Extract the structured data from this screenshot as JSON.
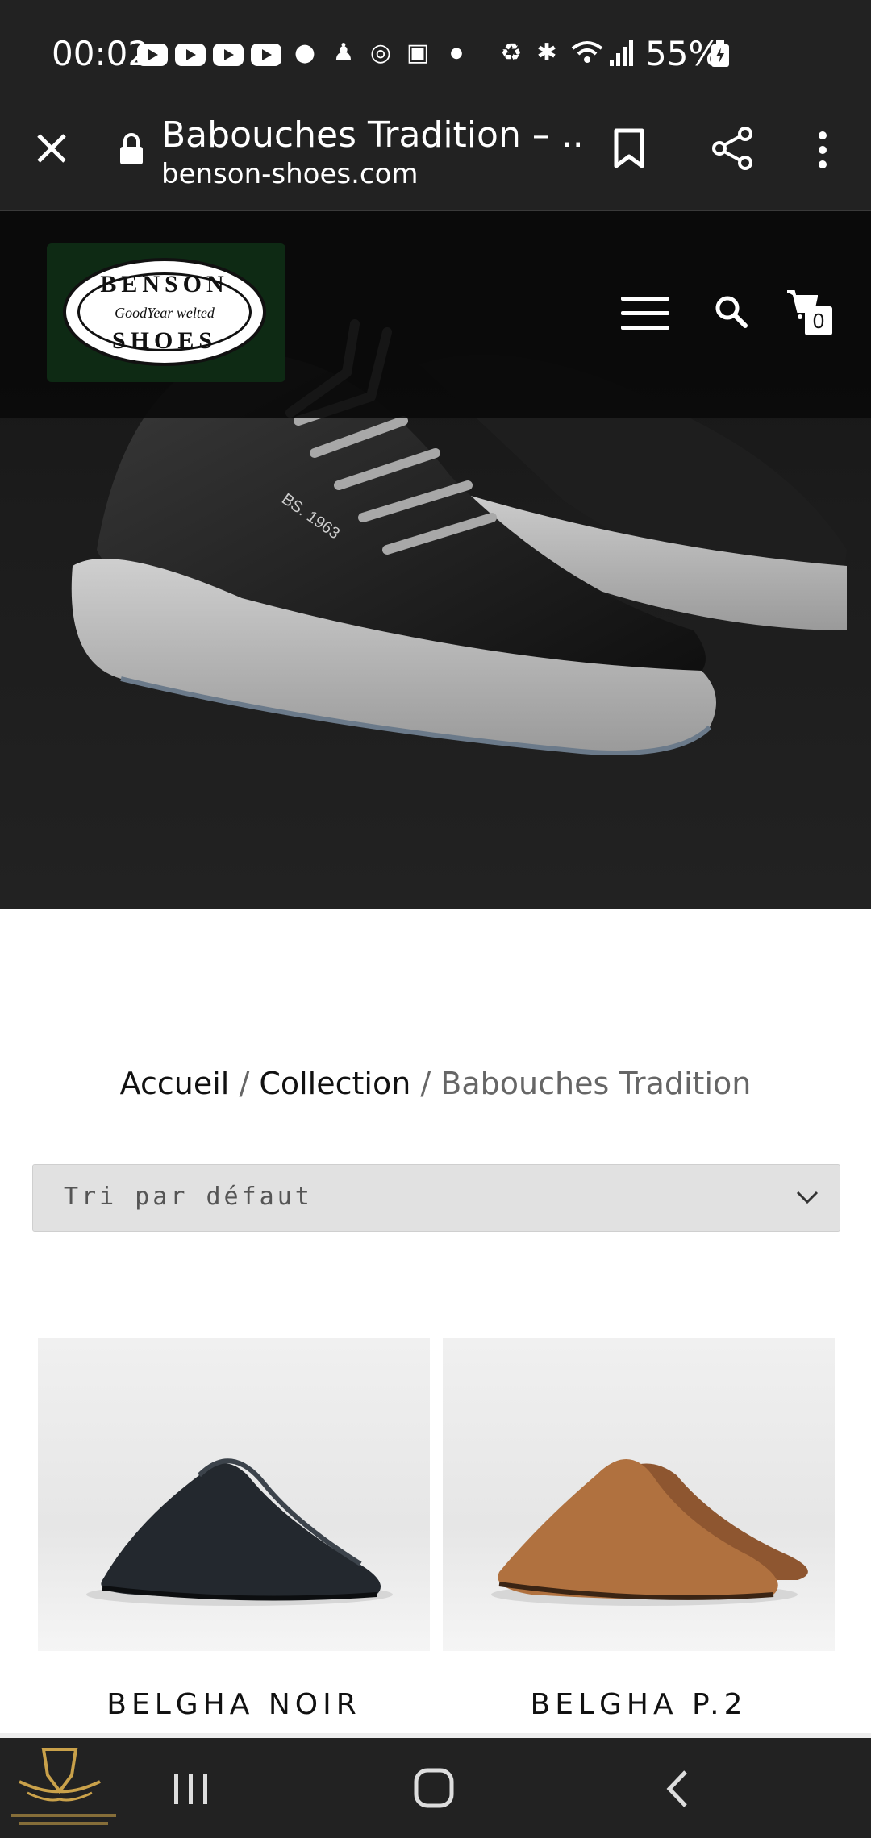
{
  "status_bar": {
    "time": "00:02",
    "battery": "55%"
  },
  "browser": {
    "title": "Babouches Tradition – ...",
    "url": "benson-shoes.com"
  },
  "site": {
    "logo": {
      "top": "BENSON",
      "middle": "GoodYear welted",
      "bottom": "SHOES"
    },
    "cart_count": "0"
  },
  "hero": {
    "shoe_print": "BS. 1963"
  },
  "breadcrumb": {
    "home": "Accueil",
    "sep1": " / ",
    "collection": "Collection",
    "sep2": " / ",
    "current": "Babouches Tradition"
  },
  "sort": {
    "selected": "Tri par défaut"
  },
  "products": [
    {
      "name": "BELGHA NOIR",
      "color": "#2a2f35"
    },
    {
      "name": "BELGHA P.2",
      "color": "#a8683a"
    }
  ],
  "colors": {
    "status_bar": "#222222",
    "accent_dark": "#111111",
    "select_bg": "#e1e1e1"
  }
}
